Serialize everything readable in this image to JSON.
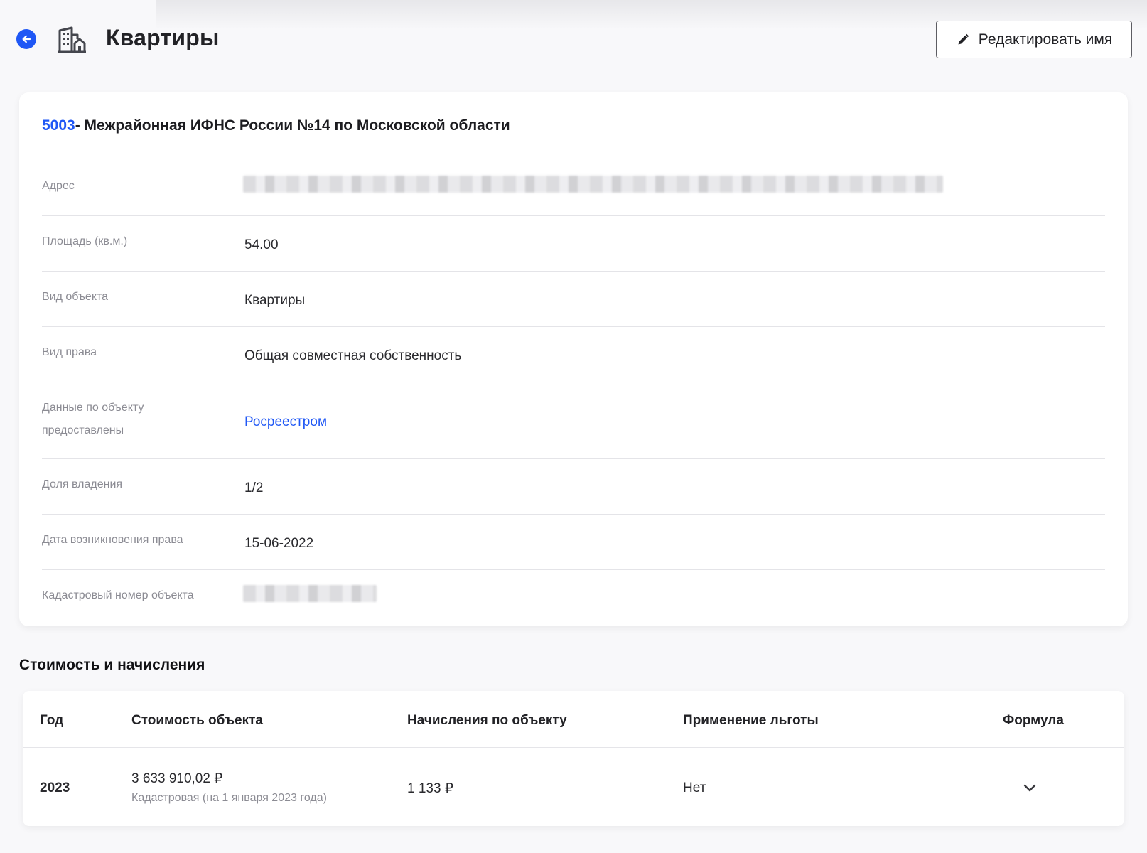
{
  "header": {
    "title": "Квартиры",
    "edit_label": "Редактировать имя"
  },
  "object": {
    "tax_code": "5003",
    "tax_authority": "- Межрайонная ИФНС России №14 по Московской области",
    "rows": [
      {
        "label": "Адрес",
        "value": ""
      },
      {
        "label": "Площадь (кв.м.)",
        "value": "54.00"
      },
      {
        "label": "Вид объекта",
        "value": "Квартиры"
      },
      {
        "label": "Вид права",
        "value": "Общая совместная собственность"
      },
      {
        "label": "Данные по объекту предоставлены",
        "value": "Росреестром"
      },
      {
        "label": "Доля владения",
        "value": "1/2"
      },
      {
        "label": "Дата возникновения права",
        "value": "15-06-2022"
      },
      {
        "label": "Кадастровый номер объекта",
        "value": ""
      }
    ]
  },
  "charges": {
    "section_title": "Стоимость и начисления",
    "columns": [
      "Год",
      "Стоимость объекта",
      "Начисления по объекту",
      "Применение льготы",
      "Формула"
    ],
    "rows": [
      {
        "year": "2023",
        "cost": "3 633 910,02 ₽",
        "cost_note": "Кадастровая (на 1 января 2023 года)",
        "charges": "1 133 ₽",
        "benefit": "Нет"
      }
    ]
  },
  "colors": {
    "accent": "#1f57f5",
    "muted_text": "#8b8b93",
    "divider": "#e4e4e8"
  },
  "icons": {
    "back": "arrow-left-circle-icon",
    "object": "building-icon",
    "edit": "pencil-icon",
    "expand": "chevron-down-icon"
  }
}
